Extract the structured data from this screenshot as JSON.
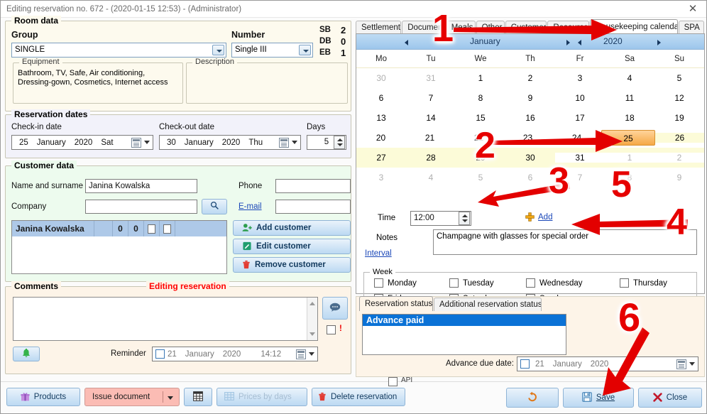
{
  "window": {
    "title": "Editing reservation no. 672 - (2020-01-15 12:53) - (Administrator)",
    "close_glyph": "✕"
  },
  "room_data": {
    "legend": "Room data",
    "group_label": "Group",
    "group_value": "SINGLE",
    "number_label": "Number",
    "number_value": "Single III",
    "beds": [
      {
        "code": "SB",
        "count": "2"
      },
      {
        "code": "DB",
        "count": "0"
      },
      {
        "code": "EB",
        "count": "1"
      }
    ],
    "equipment_legend": "Equipment",
    "equipment_value": "Bathroom, TV, Safe, Air conditioning, Dressing-gown, Cosmetics, Internet access",
    "description_legend": "Description",
    "description_value": ""
  },
  "reservation_dates": {
    "legend": "Reservation dates",
    "checkin_label": "Check-in date",
    "checkin": {
      "day": "25",
      "month": "January",
      "year": "2020",
      "weekday": "Sat"
    },
    "checkout_label": "Check-out date",
    "checkout": {
      "day": "30",
      "month": "January",
      "year": "2020",
      "weekday": "Thu"
    },
    "days_label": "Days",
    "days_value": "5"
  },
  "customer_data": {
    "legend": "Customer data",
    "name_label": "Name and surname",
    "name_value": "Janina Kowalska",
    "company_label": "Company",
    "company_value": "",
    "phone_label": "Phone",
    "phone_value": "",
    "email_label": "E-mail",
    "email_value": "",
    "search_icon": "magnifier-icon",
    "list_row": {
      "name": "Janina Kowalska",
      "num1": "0",
      "num2": "0"
    },
    "buttons": [
      {
        "label": "Add customer",
        "icon": "add-user-icon",
        "name": "add-customer-button"
      },
      {
        "label": "Edit customer",
        "icon": "pencil-icon",
        "name": "edit-customer-button"
      },
      {
        "label": "Remove customer",
        "icon": "trash-icon",
        "name": "remove-customer-button"
      }
    ]
  },
  "comments": {
    "legend": "Comments",
    "mode_label": "Editing reservation",
    "textarea_value": "",
    "bell_icon": "bell-icon",
    "chat_icon": "chat-bubble-icon",
    "exclaim": "!",
    "reminder_label": "Reminder",
    "reminder": {
      "day": "21",
      "month": "January",
      "year": "2020",
      "time": "14:12"
    }
  },
  "bottom_left_buttons": [
    {
      "label": "Products",
      "icon": "gift-icon",
      "name": "products-button"
    },
    {
      "label": "Issue document",
      "icon": "",
      "name": "issue-document-button"
    },
    {
      "label": "",
      "icon": "grid-icon",
      "name": "calculator-grid-button"
    },
    {
      "label": "Prices by days",
      "icon": "table-icon",
      "name": "prices-by-days-button"
    },
    {
      "label": "Delete reservation",
      "icon": "trash-icon",
      "name": "delete-reservation-button"
    }
  ],
  "right_panel": {
    "tabs": [
      {
        "label": "Settlement",
        "active": false
      },
      {
        "label": "Documents",
        "active": false
      },
      {
        "label": "Meals",
        "active": false
      },
      {
        "label": "Other",
        "active": false
      },
      {
        "label": "Customers",
        "active": false
      },
      {
        "label": "Resources",
        "active": false
      },
      {
        "label": "Housekeeping calendar",
        "active": true
      },
      {
        "label": "SPA",
        "active": false
      }
    ],
    "calendar": {
      "month": "January",
      "year": "2020",
      "dow": [
        "Mo",
        "Tu",
        "We",
        "Th",
        "Fr",
        "Sa",
        "Su"
      ],
      "weeks": [
        [
          {
            "d": "30",
            "out": true
          },
          {
            "d": "31",
            "out": true
          },
          {
            "d": "1"
          },
          {
            "d": "2"
          },
          {
            "d": "3"
          },
          {
            "d": "4"
          },
          {
            "d": "5"
          }
        ],
        [
          {
            "d": "6"
          },
          {
            "d": "7"
          },
          {
            "d": "8"
          },
          {
            "d": "9"
          },
          {
            "d": "10"
          },
          {
            "d": "11"
          },
          {
            "d": "12"
          }
        ],
        [
          {
            "d": "13"
          },
          {
            "d": "14"
          },
          {
            "d": "15"
          },
          {
            "d": "16"
          },
          {
            "d": "17"
          },
          {
            "d": "18"
          },
          {
            "d": "19"
          }
        ],
        [
          {
            "d": "20"
          },
          {
            "d": "21"
          },
          {
            "d": "22"
          },
          {
            "d": "23"
          },
          {
            "d": "24"
          },
          {
            "d": "25",
            "selected": true
          },
          {
            "d": "26",
            "inrange": true
          }
        ],
        [
          {
            "d": "27",
            "inrange": true
          },
          {
            "d": "28",
            "inrange": true
          },
          {
            "d": "29",
            "inrange": true
          },
          {
            "d": "30",
            "inrange": true
          },
          {
            "d": "31"
          },
          {
            "d": "1",
            "out": true
          },
          {
            "d": "2",
            "out": true
          }
        ],
        [
          {
            "d": "3",
            "out": true
          },
          {
            "d": "4",
            "out": true
          },
          {
            "d": "5",
            "out": true
          },
          {
            "d": "6",
            "out": true
          },
          {
            "d": "7",
            "out": true
          },
          {
            "d": "8",
            "out": true
          },
          {
            "d": "9",
            "out": true
          }
        ]
      ]
    },
    "time_label": "Time",
    "time_value": "12:00",
    "add_label": "Add",
    "add_icon": "plus-icon",
    "notes_label": "Notes",
    "notes_value": "Champagne with glasses for special order",
    "interval_label": "Interval",
    "week_legend": "Week",
    "weekdays": [
      "Monday",
      "Tuesday",
      "Wednesday",
      "Thursday",
      "Friday",
      "Saturday",
      "Sunday"
    ]
  },
  "status_panel": {
    "tabs": [
      {
        "label": "Reservation status",
        "active": true
      },
      {
        "label": "Additional reservation status",
        "active": false
      }
    ],
    "selected_status": "Advance paid",
    "advance_due_label": "Advance due date:",
    "advance_due": {
      "day": "21",
      "month": "January",
      "year": "2020"
    }
  },
  "footer": {
    "api_label": "API",
    "undo_icon": "undo-icon",
    "save_label": "Save",
    "save_icon": "floppy-icon",
    "close_label": "Close",
    "close_icon": "x-icon"
  },
  "callouts": [
    {
      "n": "1"
    },
    {
      "n": "2"
    },
    {
      "n": "3"
    },
    {
      "n": "4"
    },
    {
      "n": "5"
    },
    {
      "n": "6"
    }
  ],
  "colors": {
    "accent_red": "#e60000",
    "selected_day": "#f5a947",
    "range_day": "#fcfbd8",
    "status_selected": "#0b72d6"
  }
}
